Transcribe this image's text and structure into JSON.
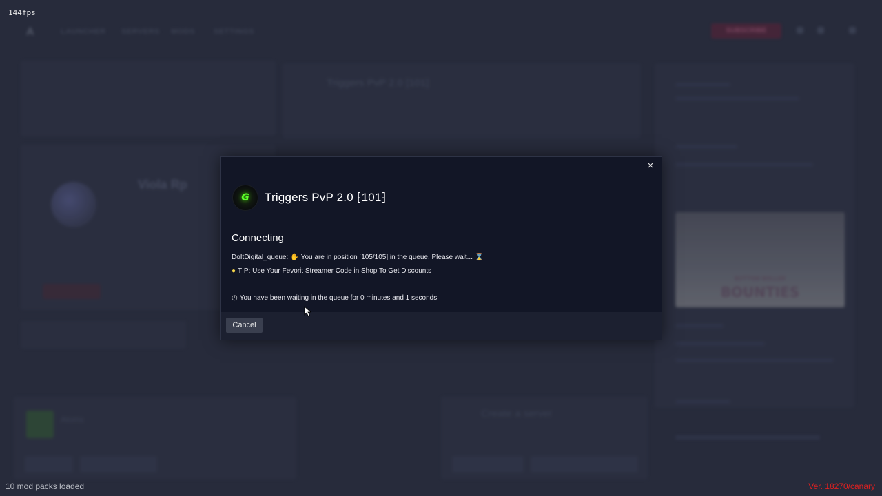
{
  "overlay": {
    "fps": "144fps",
    "mod_packs": "10 mod packs loaded",
    "version": "Ver. 18270/canary"
  },
  "background": {
    "nav_items": [
      "LAUNCHER",
      "SERVERS",
      "MODS",
      "SETTINGS"
    ],
    "subscribe_label": "SUBSCRIBE",
    "header_title": "Triggers PvP 2.0 [101]",
    "server_name": "Viola Rp",
    "atom_label": "Atoms",
    "create_label": "Create a server",
    "bounty_top": "BUTTON BOLLER",
    "bounty_main": "BOUNTIES"
  },
  "modal": {
    "close_label": "×",
    "server_logo_glyph": "G",
    "server_title": "Triggers PvP 2.0 ⁅101⁆",
    "status_heading": "Connecting",
    "queue_prefix": "DoItDigital_queue:",
    "queue_text": "You are in position [105/105] in the queue. Please wait...",
    "tip_text": "TIP: Use Your Fevorit Streamer Code in Shop To Get Discounts",
    "wait_text": "You have been waiting in the queue for 0 minutes and 1 seconds",
    "cancel_label": "Cancel"
  },
  "icons": {
    "hand": "hand-icon",
    "hourglass": "hourglass-icon",
    "bulb": "lightbulb-icon",
    "clock": "clock-icon",
    "close": "close-icon",
    "cursor": "mouse-cursor-icon"
  },
  "colors": {
    "modal_bg": "#121626",
    "modal_footer": "#1c2030",
    "version_red": "#e02020",
    "logo_green": "#5cff2a"
  }
}
